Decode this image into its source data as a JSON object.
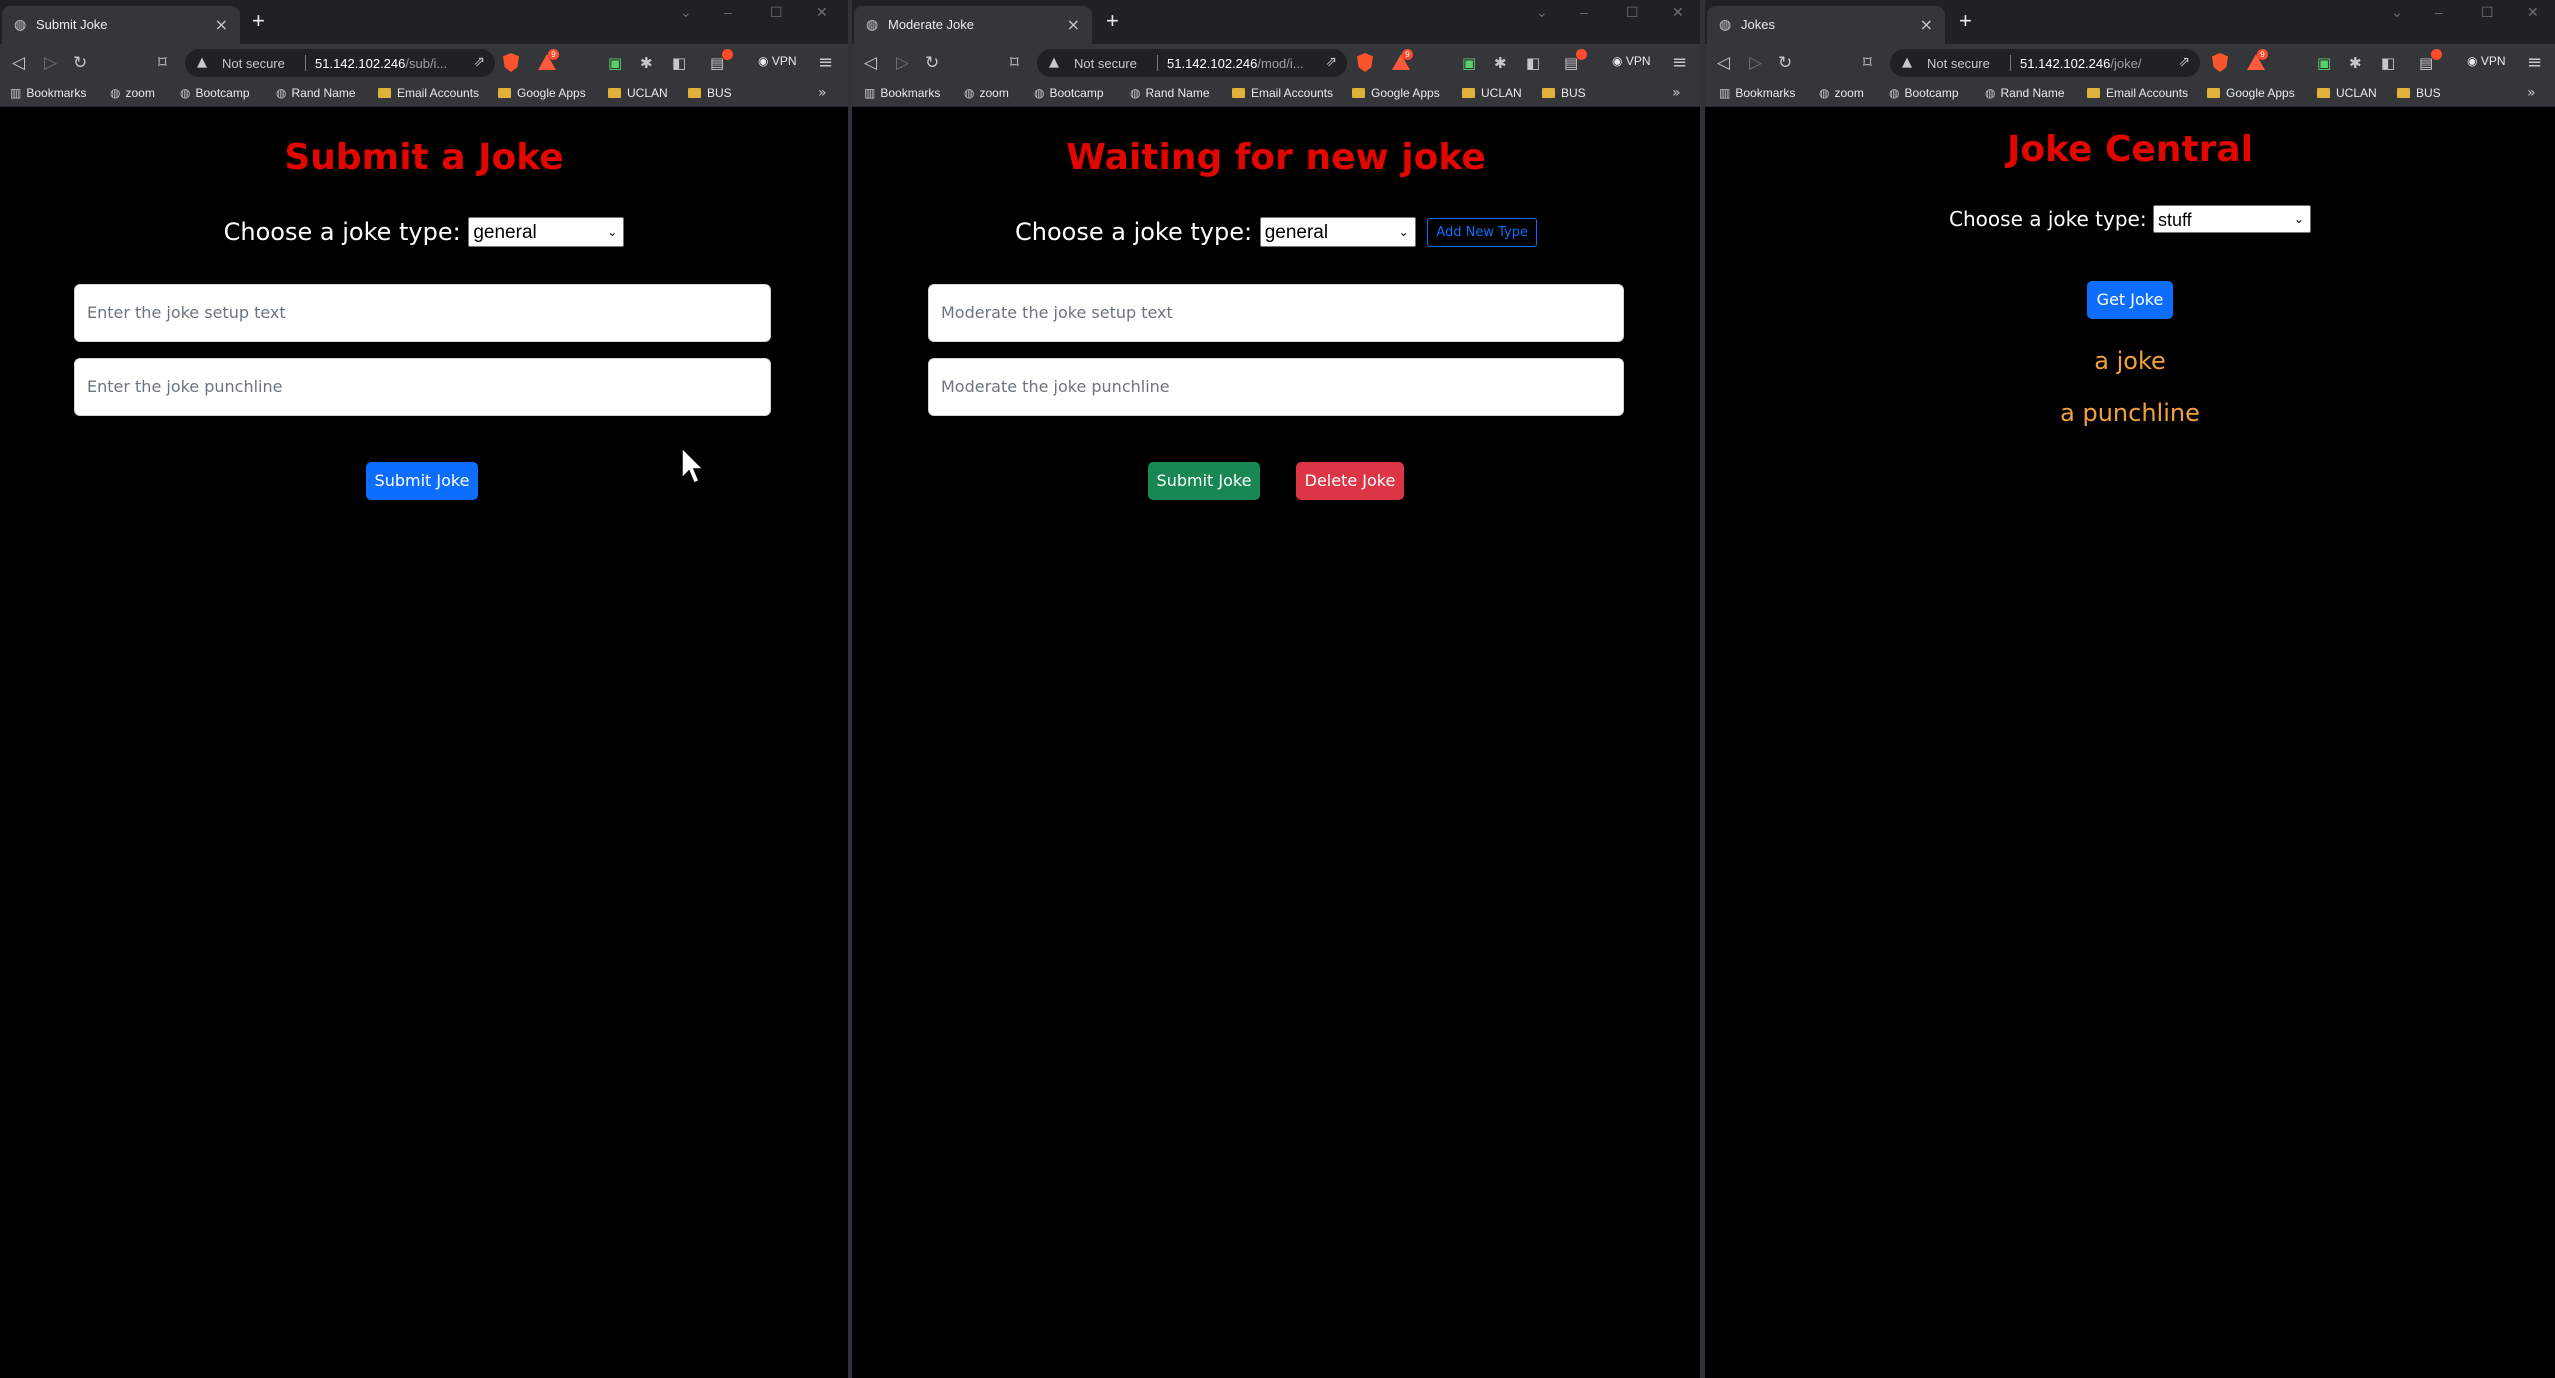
{
  "windows": [
    {
      "tab_title": "Submit Joke",
      "not_secure": "Not secure",
      "url_host": "51.142.102.246",
      "url_path": "/sub/i...",
      "vpn": "VPN",
      "bookmarks": [
        "Bookmarks",
        "zoom",
        "Bootcamp",
        "Rand Name",
        "Email Accounts",
        "Google Apps",
        "UCLAN",
        "BUS"
      ],
      "page_title": "Submit a Joke",
      "joke_type_label": "Choose a joke type:",
      "joke_type_value": "general",
      "setup_placeholder": "Enter the joke setup text",
      "punchline_placeholder": "Enter the joke punchline",
      "submit_label": "Submit Joke"
    },
    {
      "tab_title": "Moderate Joke",
      "not_secure": "Not secure",
      "url_host": "51.142.102.246",
      "url_path": "/mod/i...",
      "vpn": "VPN",
      "bookmarks": [
        "Bookmarks",
        "zoom",
        "Bootcamp",
        "Rand Name",
        "Email Accounts",
        "Google Apps",
        "UCLAN",
        "BUS"
      ],
      "page_title": "Waiting for new joke",
      "joke_type_label": "Choose a joke type:",
      "joke_type_value": "general",
      "add_type_label": "Add New Type",
      "setup_placeholder": "Moderate the joke setup text",
      "punchline_placeholder": "Moderate the joke punchline",
      "submit_label": "Submit Joke",
      "delete_label": "Delete Joke"
    },
    {
      "tab_title": "Jokes",
      "not_secure": "Not secure",
      "url_host": "51.142.102.246",
      "url_path": "/joke/",
      "vpn": "VPN",
      "bookmarks": [
        "Bookmarks",
        "zoom",
        "Bootcamp",
        "Rand Name",
        "Email Accounts",
        "Google Apps",
        "UCLAN",
        "BUS"
      ],
      "page_title": "Joke Central",
      "joke_type_label": "Choose a joke type:",
      "joke_type_value": "stuff",
      "get_joke_label": "Get Joke",
      "joke_setup": "a joke",
      "joke_punchline": "a punchline"
    }
  ],
  "colors": {
    "title_red": "#e10600",
    "primary_blue": "#0d6efd",
    "success_green": "#198754",
    "danger_red": "#dc3545",
    "joke_orange": "#f2a13c"
  },
  "icons": [
    "back-icon",
    "forward-icon",
    "reload-icon",
    "bookmark-icon",
    "warning-icon",
    "share-icon",
    "brave-shield-icon",
    "brave-rewards-icon",
    "extension-icon",
    "sidebar-icon",
    "wallet-icon",
    "menu-icon",
    "folder-icon",
    "globe-icon",
    "mouse-cursor-icon"
  ]
}
